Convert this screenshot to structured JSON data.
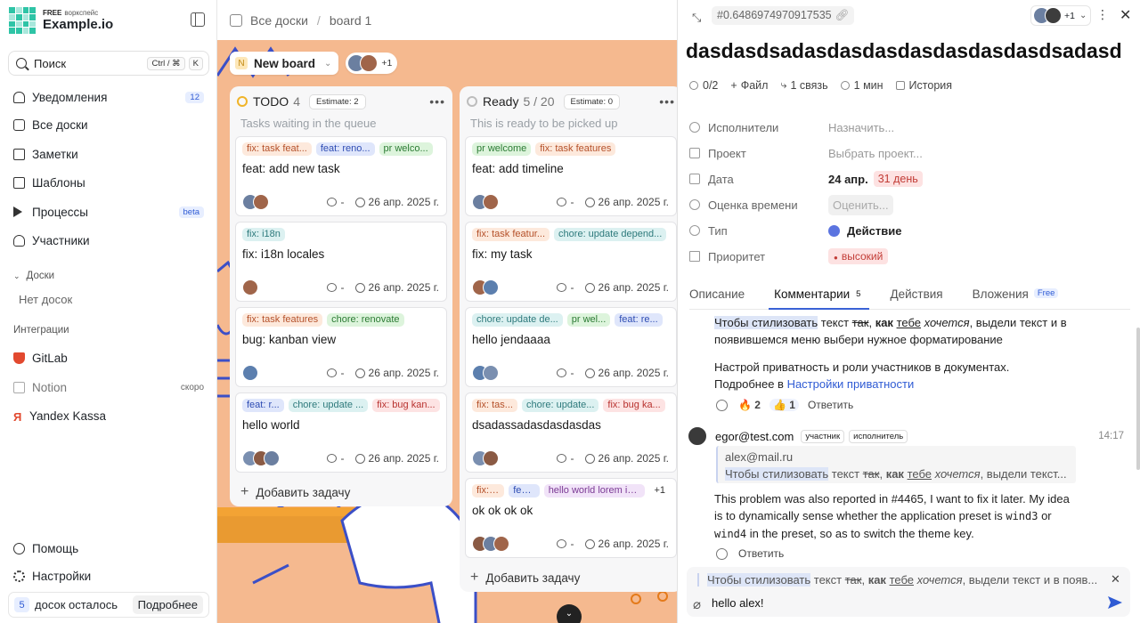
{
  "sidebar": {
    "brand": {
      "plan": "FREE",
      "workspace_label": "воркспейс",
      "name": "Example.io"
    },
    "search": {
      "label": "Поиск",
      "shortcut": [
        "Ctrl / ⌘",
        "K"
      ]
    },
    "nav": [
      {
        "label": "Уведомления",
        "icon": "bell-icon",
        "badge": "12"
      },
      {
        "label": "Все доски",
        "icon": "boards-icon"
      },
      {
        "label": "Заметки",
        "icon": "notes-icon"
      },
      {
        "label": "Шаблоны",
        "icon": "templates-icon"
      },
      {
        "label": "Процессы",
        "icon": "play-icon",
        "badge": "beta"
      },
      {
        "label": "Участники",
        "icon": "users-icon"
      }
    ],
    "boards_section": {
      "label": "Доски",
      "empty": "Нет досок"
    },
    "integrations": {
      "label": "Интеграции",
      "items": [
        {
          "label": "GitLab",
          "icon": "gitlab-icon"
        },
        {
          "label": "Notion",
          "icon": "notion-icon",
          "badge": "скоро"
        },
        {
          "label": "Yandex Kassa",
          "icon": "yandex-icon"
        }
      ]
    },
    "footer": {
      "help": "Помощь",
      "settings": "Настройки",
      "boards_left_num": "5",
      "boards_left_text": "досок осталось",
      "more": "Подробнее"
    }
  },
  "breadcrumb": {
    "root": "Все доски",
    "current": "board 1"
  },
  "board": {
    "name": "New board",
    "letter": "N",
    "members_more": "+1"
  },
  "columns": [
    {
      "name": "TODO",
      "count": "4",
      "estimate": "Estimate: 2",
      "desc": "Tasks waiting in the queue",
      "status_color": "#f0b429",
      "cards": [
        {
          "tags": [
            [
              "fix",
              "fix: task feat..."
            ],
            [
              "feat",
              "feat: reno..."
            ],
            [
              "pr",
              "pr welco..."
            ]
          ],
          "title": "feat: add new task",
          "date": "26 апр. 2025 г.",
          "comments": "-",
          "avatars": 2
        },
        {
          "tags": [
            [
              "chore",
              "fix: i18n"
            ]
          ],
          "title": "fix: i18n locales",
          "date": "26 апр. 2025 г.",
          "comments": "-",
          "avatars": 1
        },
        {
          "tags": [
            [
              "fix",
              "fix: task features"
            ],
            [
              "pr",
              "chore: renovate"
            ]
          ],
          "title": "bug: kanban view",
          "date": "26 апр. 2025 г.",
          "comments": "-",
          "avatars": 1
        },
        {
          "tags": [
            [
              "feat",
              "feat: r..."
            ],
            [
              "chore",
              "chore: update ..."
            ],
            [
              "bug",
              "fix: bug kan..."
            ]
          ],
          "title": "hello world",
          "date": "26 апр. 2025 г.",
          "comments": "-",
          "avatars": 3
        }
      ],
      "add": "Добавить задачу"
    },
    {
      "name": "Ready",
      "count": "5 / 20",
      "estimate": "Estimate: 0",
      "desc": "This is ready to be picked up",
      "status_color": "#bdbdbd",
      "cards": [
        {
          "tags": [
            [
              "pr",
              "pr welcome"
            ],
            [
              "fix",
              "fix: task features"
            ]
          ],
          "title": "feat: add timeline",
          "date": "26 апр. 2025 г.",
          "comments": "-",
          "avatars": 2
        },
        {
          "tags": [
            [
              "fix",
              "fix: task featur..."
            ],
            [
              "chore",
              "chore: update depend..."
            ]
          ],
          "title": "fix: my task",
          "date": "26 апр. 2025 г.",
          "comments": "-",
          "avatars": 2
        },
        {
          "tags": [
            [
              "chore",
              "chore: update de..."
            ],
            [
              "pr",
              "pr wel..."
            ],
            [
              "feat",
              "feat: re..."
            ]
          ],
          "title": "hello jendaaaa",
          "date": "26 апр. 2025 г.",
          "comments": "-",
          "avatars": 2
        },
        {
          "tags": [
            [
              "fix",
              "fix: tas..."
            ],
            [
              "chore",
              "chore: update..."
            ],
            [
              "bug",
              "fix: bug ka..."
            ]
          ],
          "title": "dsadassadasdasdasdas",
          "date": "26 апр. 2025 г.",
          "comments": "-",
          "avatars": 2
        },
        {
          "tags": [
            [
              "fix",
              "fix: ..."
            ],
            [
              "feat",
              "fea..."
            ],
            [
              "hw",
              "hello world lorem ip..."
            ],
            [
              "more",
              "+1"
            ]
          ],
          "title": "ok ok ok ok",
          "date": "26 апр. 2025 г.",
          "comments": "-",
          "avatars": 3
        }
      ],
      "add": "Добавить задачу"
    }
  ],
  "task": {
    "id": "#0.6486974970917535",
    "members_more": "+1",
    "title": "dasdasdsadasdasdasdasdasdasdasdsadasd",
    "meta": [
      {
        "icon": "progress-icon",
        "label": "0/2"
      },
      {
        "icon": "plus-icon",
        "label": "Файл"
      },
      {
        "icon": "link-icon",
        "label": "1 связь"
      },
      {
        "icon": "timer-icon",
        "label": "1 мин"
      },
      {
        "icon": "history-icon",
        "label": "История"
      }
    ],
    "props": {
      "assignees": {
        "label": "Исполнители",
        "value": "Назначить..."
      },
      "project": {
        "label": "Проект",
        "value": "Выбрать проект..."
      },
      "date": {
        "label": "Дата",
        "value": "24 апр.",
        "overdue": "31 день"
      },
      "estimate": {
        "label": "Оценка времени",
        "value": "Оценить..."
      },
      "type": {
        "label": "Тип",
        "value": "Действие"
      },
      "priority": {
        "label": "Приоритет",
        "value": "высокий"
      }
    },
    "tabs": {
      "description": "Описание",
      "comments": "Комментарии",
      "comments_count": "5",
      "actions": "Действия",
      "attachments": "Вложения",
      "attachments_badge": "Free"
    },
    "comment1": {
      "p1_hl": "Чтобы стилизовать",
      "p1_a": " текст ",
      "p1_strike": "так",
      "p1_b": ", ",
      "p1_bold": "как",
      "p1_c": " ",
      "p1_u": "тебе",
      "p1_d": " ",
      "p1_i": "хочется",
      "p1_e": ", выдели текст и в появившемся меню выбери нужное форматирование",
      "p2": "Настрой приватность и роли участников в документах.",
      "p3": "Подробнее в ",
      "p3_link": "Настройки приватности",
      "reactions": [
        {
          "emoji": "🔥",
          "count": "2"
        },
        {
          "emoji": "👍",
          "count": "1"
        }
      ],
      "reply": "Ответить"
    },
    "comment2": {
      "author": "egor@test.com",
      "roles": [
        "участник",
        "исполнитель"
      ],
      "time": "14:17",
      "quote_author": "alex@mail.ru",
      "quote_hl": "Чтобы стилизовать",
      "quote_rest": " текст ",
      "quote_strike": "так",
      "quote_b": ", ",
      "quote_bold": "как",
      "quote_c": " ",
      "quote_u": "тебе",
      "quote_d": " ",
      "quote_i": "хочется",
      "quote_e": ", выдели текст...",
      "body1": "This problem was also reported in #4465, I want to fix it later. My idea is to dynamically sense whether the application preset is ",
      "code1": "wind3",
      "body2": " or ",
      "code2": "wind4",
      "body3": " in the preset, so as to switch the theme key.",
      "reply": "Ответить"
    },
    "composer": {
      "reply_hl": "Чтобы стилизовать",
      "reply_a": " текст ",
      "reply_strike": "так",
      "reply_b": ", ",
      "reply_bold": "как",
      "reply_c": " ",
      "reply_u": "тебе",
      "reply_d": " ",
      "reply_i": "хочется",
      "reply_e": ", выдели текст и в появ...",
      "value": "hello alex!"
    }
  },
  "colors": {
    "accent": "#2f5bd4",
    "board_bg": "#f5b98f",
    "danger": "#c23c36"
  }
}
